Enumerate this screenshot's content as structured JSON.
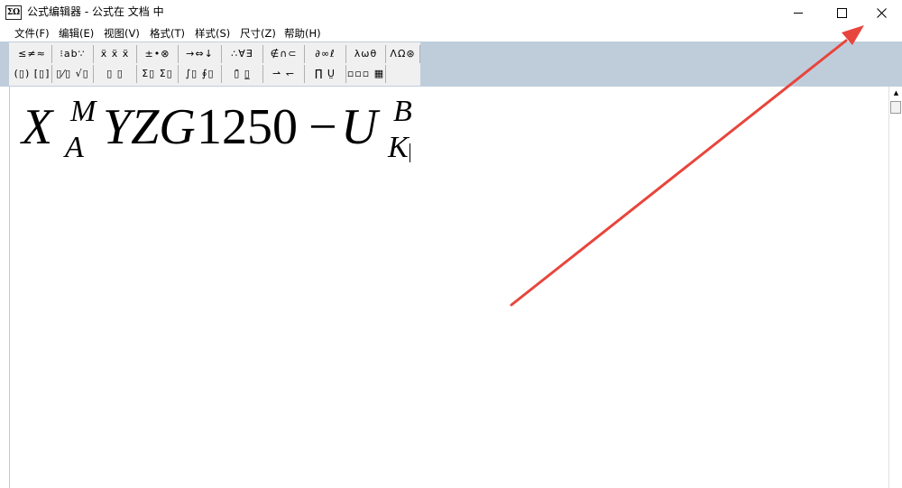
{
  "window": {
    "title": "公式编辑器 - 公式在 文档 中",
    "app_icon_label": "ΣΩ",
    "controls": {
      "minimize": "minimize",
      "maximize": "maximize",
      "close": "close"
    }
  },
  "menubar": [
    {
      "label": "文件(F)"
    },
    {
      "label": "编辑(E)"
    },
    {
      "label": "视图(V)"
    },
    {
      "label": "格式(T)"
    },
    {
      "label": "样式(S)"
    },
    {
      "label": "尺寸(Z)"
    },
    {
      "label": "帮助(H)"
    }
  ],
  "toolbar": {
    "row1": [
      {
        "name": "relations-palette",
        "symbols": "≤≠≈"
      },
      {
        "name": "spaces-palette",
        "symbols": "⁝ab∵"
      },
      {
        "name": "embellishments-palette",
        "symbols": "ẍ ẍ ẍ"
      },
      {
        "name": "operators-palette",
        "symbols": "±•⊗"
      },
      {
        "name": "arrows-palette",
        "symbols": "→⇔↓"
      },
      {
        "name": "logic-palette",
        "symbols": "∴∀∃"
      },
      {
        "name": "set-theory-palette",
        "symbols": "∉∩⊂"
      },
      {
        "name": "misc-symbols-palette",
        "symbols": "∂∞ℓ"
      },
      {
        "name": "greek-lower-palette",
        "symbols": "λωθ"
      },
      {
        "name": "greek-upper-palette",
        "symbols": "ΛΩ⊛"
      }
    ],
    "row2": [
      {
        "name": "fences-palette",
        "symbols": "(▯) [▯]"
      },
      {
        "name": "fractions-radicals-palette",
        "symbols": "▯⁄▯ √▯"
      },
      {
        "name": "scripts-palette",
        "symbols": "▯ ▯"
      },
      {
        "name": "summation-palette",
        "symbols": "Σ▯ Σ▯"
      },
      {
        "name": "integrals-palette",
        "symbols": "∫▯ ∮▯"
      },
      {
        "name": "bars-palette",
        "symbols": "▯̄ ▯̲"
      },
      {
        "name": "labeled-arrows-palette",
        "symbols": "⇀ ↽"
      },
      {
        "name": "products-palette",
        "symbols": "∏̇ Ṳ"
      },
      {
        "name": "matrices-palette",
        "symbols": "▫▫▫ ▦"
      }
    ]
  },
  "equation": {
    "base1": "X",
    "sup1": "M",
    "sub1": "A",
    "body": "YZG",
    "number": "1250",
    "minus": "−",
    "base2": "U",
    "sup2": "B",
    "sub2": "K"
  },
  "annotation": {
    "color": "#e8453c"
  }
}
